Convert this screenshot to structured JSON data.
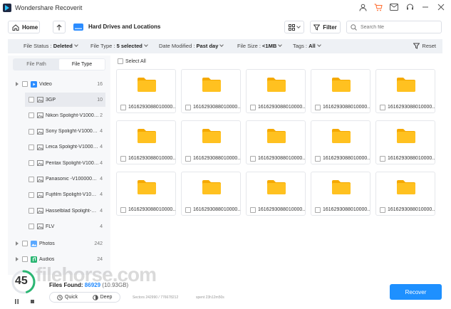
{
  "window": {
    "title": "Wondershare Recoverit"
  },
  "toolbar": {
    "home_label": "Home",
    "breadcrumb": "Hard Drives and Locations",
    "filter_label": "Filter",
    "search_placeholder": "Search file"
  },
  "filters": {
    "file_status_label": "File Status :",
    "file_status_value": "Deleted",
    "file_type_label": "File Type :",
    "file_type_value": "5 selected",
    "date_label": "Date Modified :",
    "date_value": "Past day",
    "size_label": "File Size :",
    "size_value": "<1MB",
    "tags_label": "Tags :",
    "tags_value": "All",
    "reset_label": "Reset"
  },
  "sidebar": {
    "tabs": [
      "File Path",
      "File Type"
    ],
    "video": {
      "label": "Video",
      "count": "16"
    },
    "items": [
      {
        "label": "3GP",
        "count": "10"
      },
      {
        "label": "Nikon Spolight-V100000...",
        "count": "2"
      },
      {
        "label": "Sony Spolight-V100000...",
        "count": "4"
      },
      {
        "label": "Leica Spolight-V100000...",
        "count": "4"
      },
      {
        "label": "Pentax Spolight-V1000...",
        "count": "4"
      },
      {
        "label": "Panasonic -V100000000...",
        "count": "4"
      },
      {
        "label": "Fujifilm Spolight-V1000...",
        "count": "4"
      },
      {
        "label": "Hasselblad Spolight-V1...",
        "count": "4"
      },
      {
        "label": "FLV",
        "count": "4"
      }
    ],
    "photos": {
      "label": "Photos",
      "count": "242"
    },
    "audios": {
      "label": "Audios",
      "count": "24"
    }
  },
  "main": {
    "select_all": "Select All",
    "files": [
      "1616293088010000...",
      "1616293088010000...",
      "1616293088010000...",
      "1616293088010000...",
      "1616293088010000...",
      "1616293088010000...",
      "1616293088010000...",
      "1616293088010000...",
      "1616293088010000...",
      "1616293088010000...",
      "1616293088010000...",
      "1616293088010000...",
      "1616293088010000...",
      "1616293088010000...",
      "1616293088010000..."
    ]
  },
  "status": {
    "progress": "45",
    "files_found_label": "Files Found:",
    "files_found_count": "86929",
    "files_found_size": "(10.93GB)",
    "sectors": "Sectors 242990 / 776678212",
    "spent": "spent 23h12m50s",
    "quick_label": "Quick",
    "deep_label": "Deep",
    "recover_label": "Recover"
  },
  "watermark": "filehorse.com",
  "colors": {
    "accent": "#1e90ff",
    "folder": "#ffc120"
  }
}
